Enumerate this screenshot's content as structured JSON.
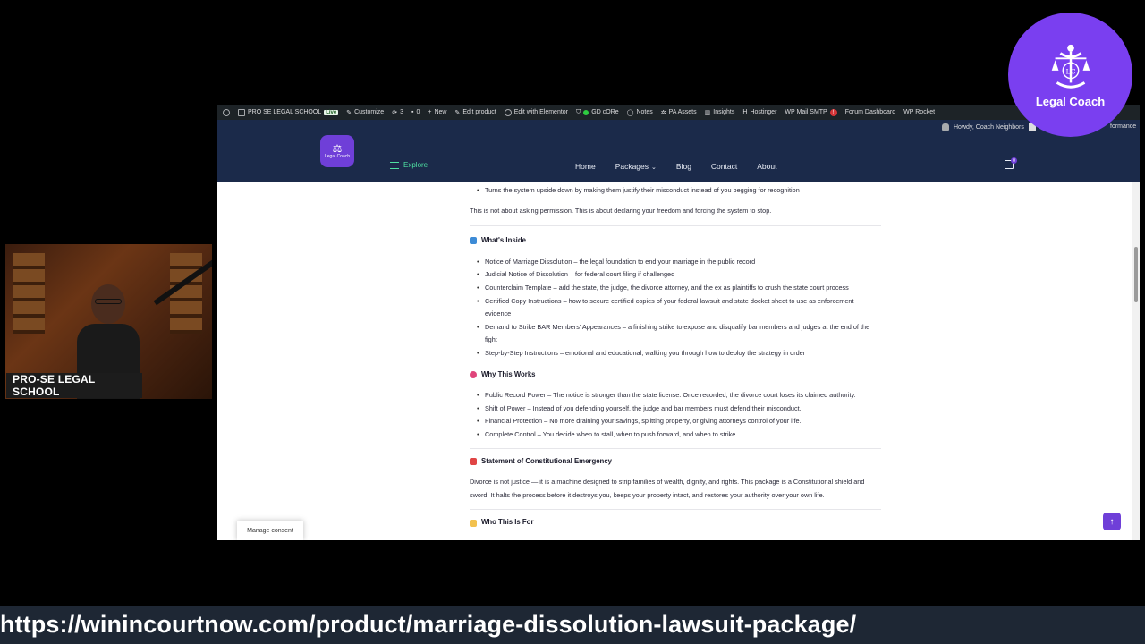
{
  "overlay": {
    "webcam_label": "PRO-SE LEGAL SCHOOL",
    "brand_name": "Legal Coach",
    "brand_initials": "LC",
    "url_text": "https://winincourtnow.com/product/marriage-dissolution-lawsuit-package/"
  },
  "wp_admin_bar": {
    "items": [
      {
        "label": "PRO SE LEGAL SCHOOL"
      },
      {
        "label": "Live"
      },
      {
        "label": "Customize"
      },
      {
        "label": "3"
      },
      {
        "label": "0"
      },
      {
        "label": "New"
      },
      {
        "label": "Edit product"
      },
      {
        "label": "Edit with Elementor"
      },
      {
        "label": "GD cORe"
      },
      {
        "label": "Notes"
      },
      {
        "label": "PA Assets"
      },
      {
        "label": "Insights"
      },
      {
        "label": "Hostinger"
      },
      {
        "label": "WP Mail SMTP"
      },
      {
        "label": "!"
      },
      {
        "label": "Forum Dashboard"
      },
      {
        "label": "WP Rocket"
      }
    ],
    "howdy": "Howdy, Coach Neighbors",
    "performance": "formance"
  },
  "site_header": {
    "logo_text": "Legal Coach",
    "explore": "Explore",
    "nav": [
      {
        "label": "Home"
      },
      {
        "label": "Packages"
      },
      {
        "label": "Blog"
      },
      {
        "label": "Contact"
      },
      {
        "label": "About"
      }
    ],
    "cart_count": "0"
  },
  "content": {
    "top_bullet": "Turns the system upside down by making them justify their misconduct instead of you begging for recognition",
    "intro_para": "This is not about asking permission. This is about declaring your freedom and forcing the system to stop.",
    "whats_inside": {
      "title": "What's Inside",
      "items": [
        "Notice of Marriage Dissolution – the legal foundation to end your marriage in the public record",
        "Judicial Notice of Dissolution – for federal court filing if challenged",
        "Counterclaim Template – add the state, the judge, the divorce attorney, and the ex as plaintiffs to crush the state court process",
        "Certified Copy Instructions – how to secure certified copies of your federal lawsuit and state docket sheet to use as enforcement evidence",
        "Demand to Strike BAR Members' Appearances – a finishing strike to expose and disqualify bar members and judges at the end of the fight",
        "Step-by-Step Instructions – emotional and educational, walking you through how to deploy the strategy in order"
      ]
    },
    "why_works": {
      "title": "Why This Works",
      "items": [
        "Public Record Power – The notice is stronger than the state license. Once recorded, the divorce court loses its claimed authority.",
        "Shift of Power – Instead of you defending yourself, the judge and bar members must defend their misconduct.",
        "Financial Protection – No more draining your savings, splitting property, or giving attorneys control of your life.",
        "Complete Control – You decide when to stall, when to push forward, and when to strike."
      ]
    },
    "emergency": {
      "title": "Statement of Constitutional Emergency",
      "para": "Divorce is not justice — it is a machine designed to strip families of wealth, dignity, and rights. This package is a Constitutional shield and sword. It halts the process before it destroys you, keeps your property intact, and restores your authority over your own life."
    },
    "who_for": {
      "title": "Who This Is For"
    }
  },
  "widgets": {
    "manage_consent": "Manage consent",
    "back_to_top": "↑"
  },
  "colors": {
    "brand_purple": "#7a3ff0",
    "header_navy": "#1b2a4a",
    "admin_bar": "#1d2327",
    "explore_green": "#4ee0a2",
    "url_bar": "#1e2734"
  }
}
